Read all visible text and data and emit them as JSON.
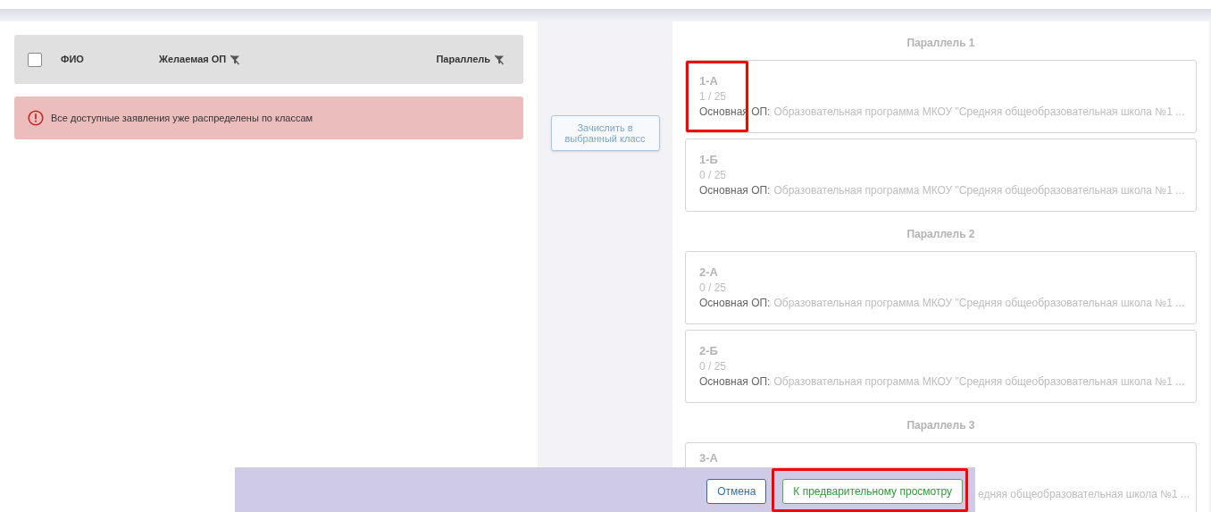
{
  "table": {
    "select_all_checked": false,
    "columns": [
      {
        "label": "ФИО",
        "filter": false
      },
      {
        "label": "Желаемая ОП",
        "filter": true
      },
      {
        "label": "Параллель",
        "filter": true
      }
    ]
  },
  "alert": {
    "kind": "error",
    "text": "Все доступные заявления уже распределены по классам"
  },
  "enroll_button": {
    "label": "Зачислить в выбранный класс",
    "disabled": true
  },
  "parallels": [
    {
      "title": "Параллель 1",
      "classes": [
        {
          "name": "1-А",
          "count": "1 / 25",
          "program_label": "Основная ОП:",
          "program": "Образовательная программа МКОУ \"Средняя общеобразовательная школа №1 ...",
          "highlighted": true
        },
        {
          "name": "1-Б",
          "count": "0 / 25",
          "program_label": "Основная ОП:",
          "program": "Образовательная программа МКОУ \"Средняя общеобразовательная школа №1 ...",
          "highlighted": false
        }
      ]
    },
    {
      "title": "Параллель 2",
      "classes": [
        {
          "name": "2-А",
          "count": "0 / 25",
          "program_label": "Основная ОП:",
          "program": "Образовательная программа МКОУ \"Средняя общеобразовательная школа №1 ...",
          "highlighted": false
        },
        {
          "name": "2-Б",
          "count": "0 / 25",
          "program_label": "Основная ОП:",
          "program": "Образовательная программа МКОУ \"Средняя общеобразовательная школа №1 ...",
          "highlighted": false
        }
      ]
    },
    {
      "title": "Параллель 3",
      "classes": [
        {
          "kind": "covered",
          "name": "3-А",
          "program": "едняя общеобразовательная школа №1 ...",
          "highlighted": false
        }
      ]
    }
  ],
  "footer": {
    "buttons": [
      {
        "label": "Отмена",
        "kind": "cancel",
        "highlighted": false
      },
      {
        "label": "К предварительному просмотру",
        "kind": "primary",
        "highlighted": true
      }
    ]
  }
}
